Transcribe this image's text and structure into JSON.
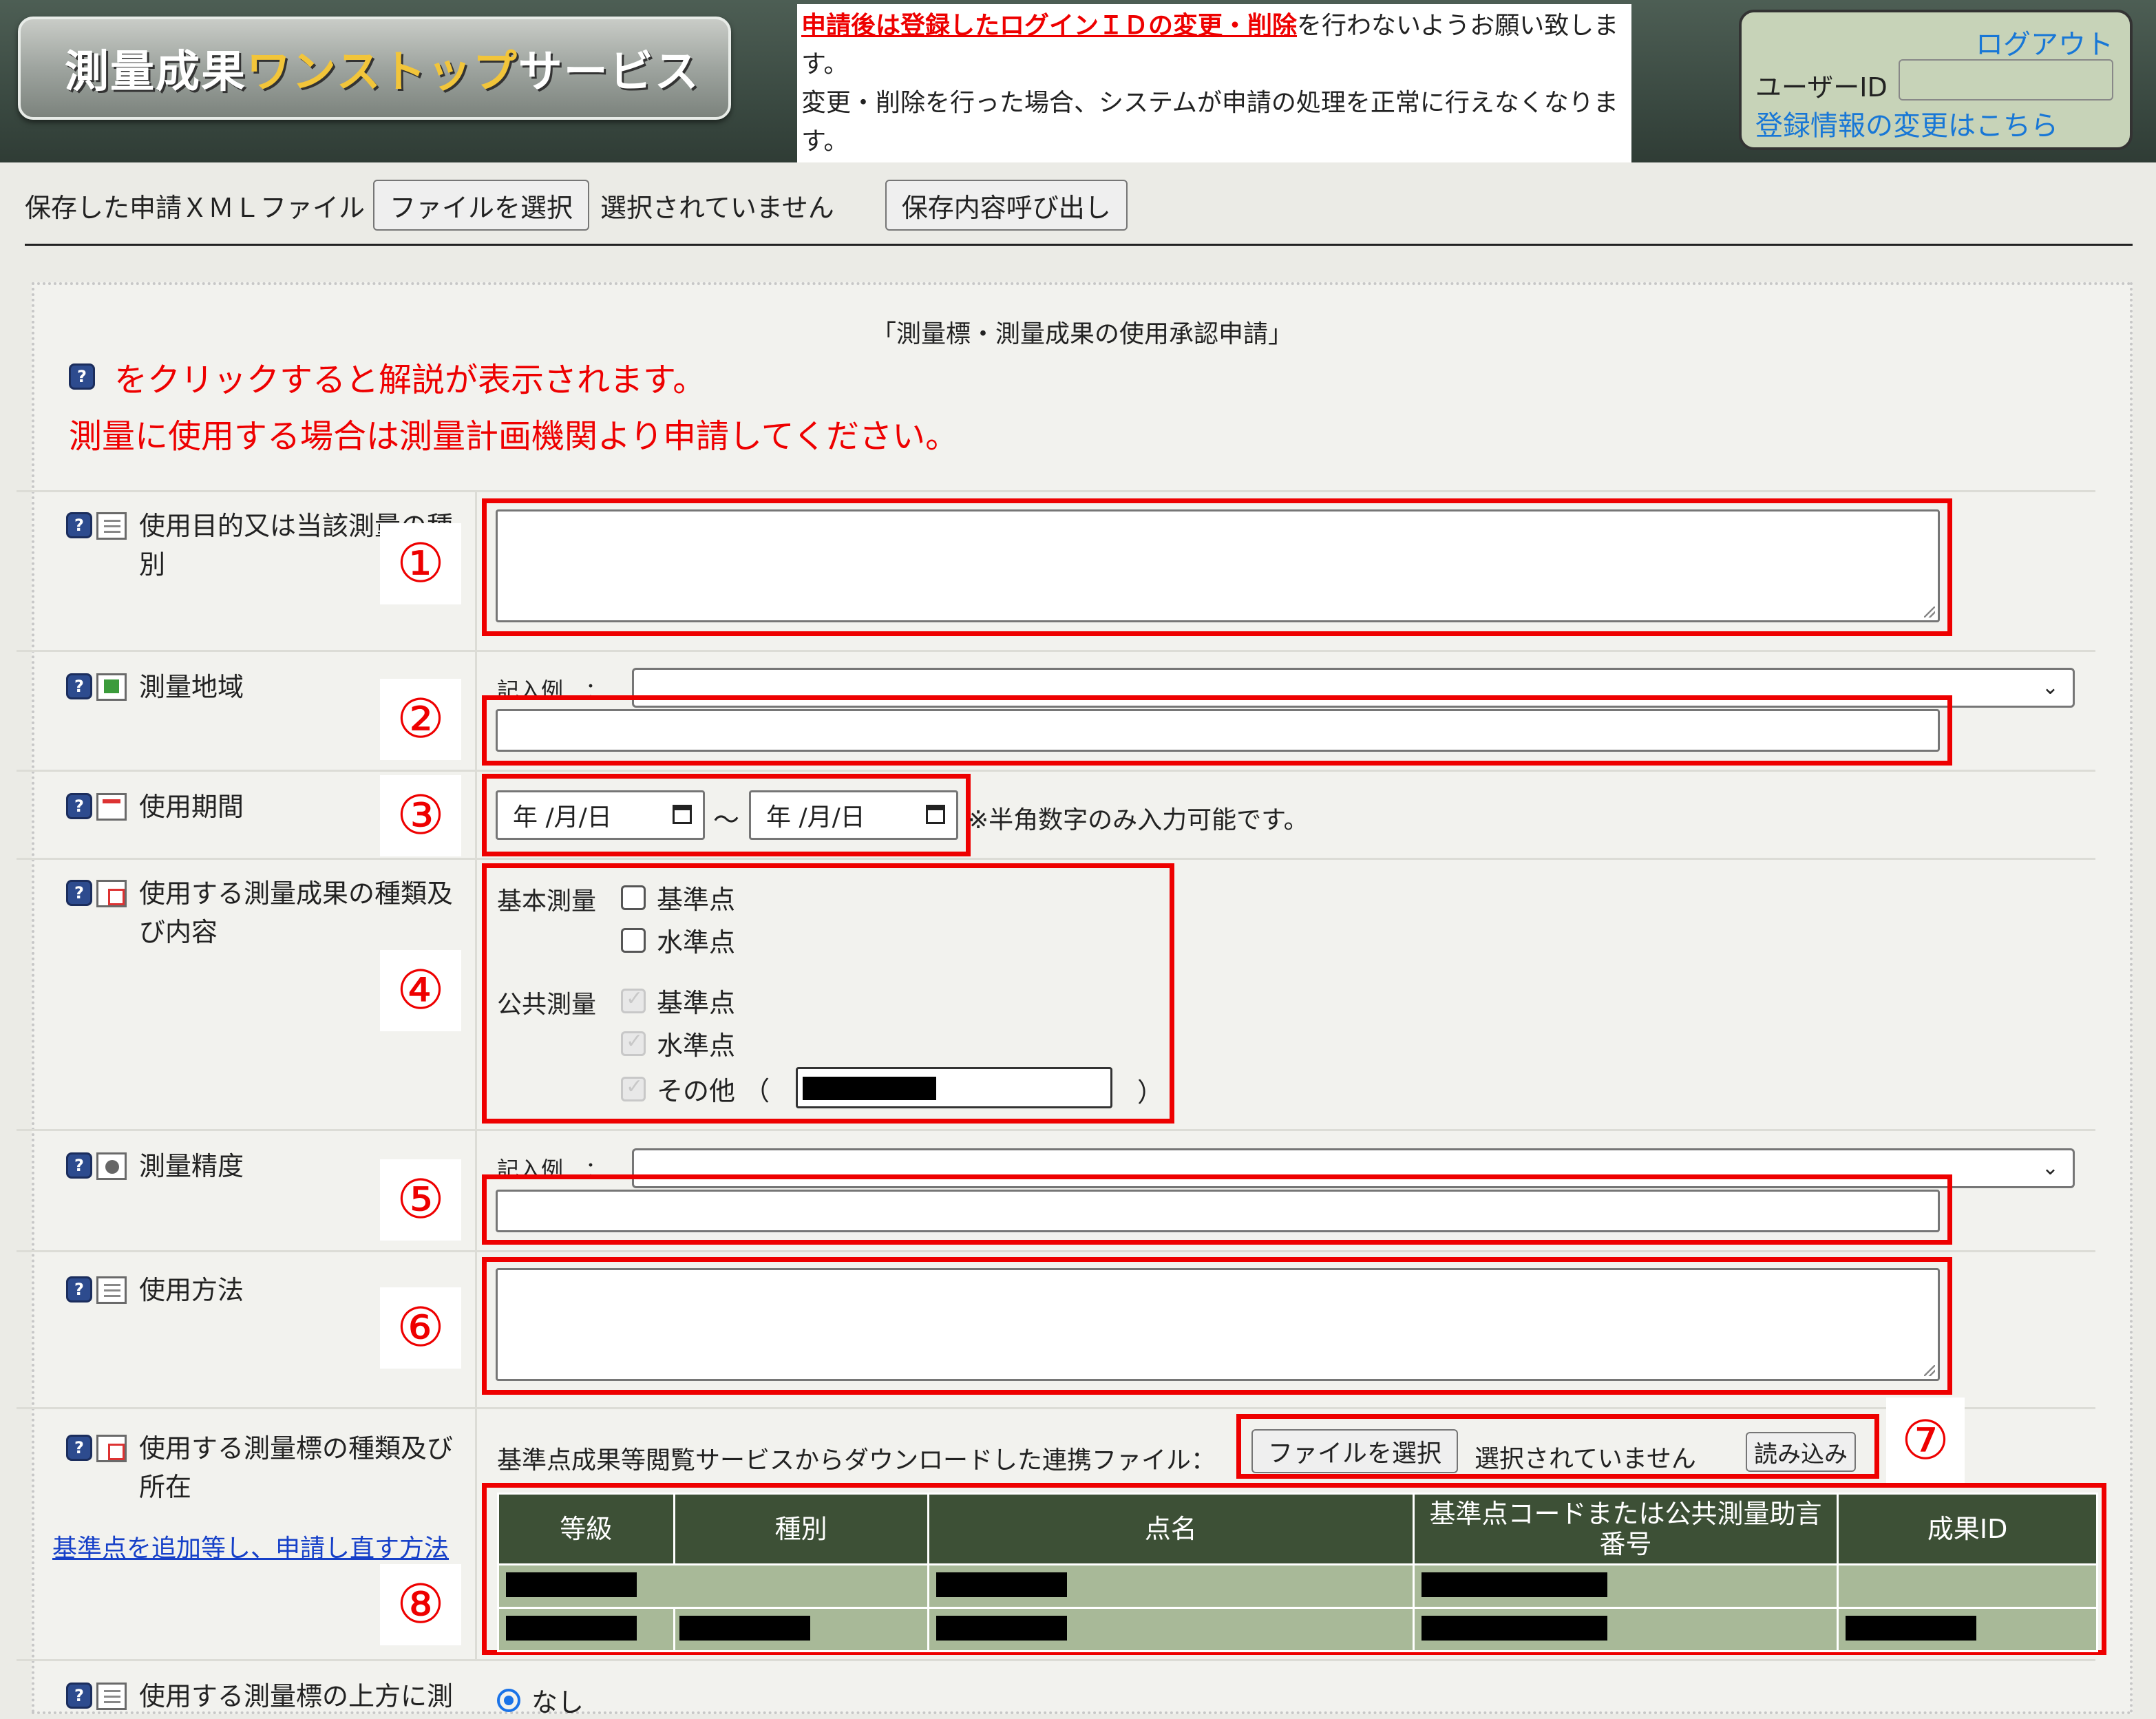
{
  "header": {
    "logo_text_a": "測量成果",
    "logo_text_b": "ワンストップ",
    "logo_text_c": "サービス",
    "notice_red": "申請後は登録したログインＩＤの変更・削除",
    "notice_1": "を行わないようお願い致します。",
    "notice_2": "変更・削除を行った場合、システムが申請の処理を正常に行えなくなります。",
    "logout": "ログアウト",
    "user_id_label": "ユーザーID",
    "change_info": "登録情報の変更はこちら"
  },
  "filebar": {
    "label": "保存した申請ＸＭＬファイル",
    "choose": "ファイルを選択",
    "none": "選択されていません",
    "load": "保存内容呼び出し"
  },
  "form": {
    "title": "「測量標・測量成果の使用承認申請」",
    "hint": "をクリックすると解説が表示されます。",
    "warn": "測量に使用する場合は測量計画機関より申請してください。",
    "purpose_label": "使用目的又は当該測量の種別",
    "area_label": "測量地域",
    "example_label": "記入例　：",
    "period_label": "使用期間",
    "date_placeholder": "年 /月/日",
    "tilde": "〜",
    "date_note": "※半角数字のみ入力可能です。",
    "kinds_label": "使用する測量成果の種類及び内容",
    "basic_survey": "基本測量",
    "public_survey": "公共測量",
    "cb_kijunten": "基準点",
    "cb_suijunten": "水準点",
    "cb_other": "その他 （",
    "cb_other_close": "）",
    "accuracy_label": "測量精度",
    "method_label": "使用方法",
    "markers_label": "使用する測量標の種類及び所在",
    "readd_link": "基準点を追加等し、申請し直す方法",
    "link_file_label": "基準点成果等閲覧サービスからダウンロードした連携ファイル：",
    "choose": "ファイルを選択",
    "none": "選択されていません",
    "read": "読み込み",
    "table_headers": [
      "等級",
      "種別",
      "点名",
      "基準点コードまたは公共測量助言番号",
      "成果ID"
    ],
    "next_label": "使用する測量標の上方に測",
    "radio_none": "なし"
  },
  "callouts": [
    "①",
    "②",
    "③",
    "④",
    "⑤",
    "⑥",
    "⑦",
    "⑧"
  ],
  "colors": {
    "accent_red": "#e00000",
    "header_dark": "#3b4a42",
    "table_head": "#3d5036",
    "table_cell": "#a8b998"
  }
}
